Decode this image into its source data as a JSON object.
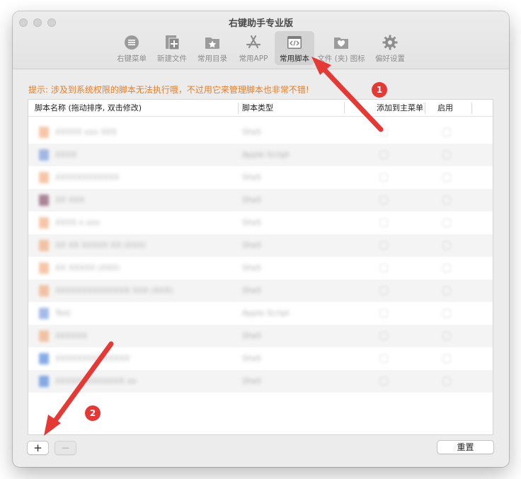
{
  "window": {
    "title": "右键助手专业版"
  },
  "toolbar": {
    "items": [
      {
        "label": "右键菜单",
        "icon": "menu-list-icon"
      },
      {
        "label": "新建文件",
        "icon": "new-file-icon"
      },
      {
        "label": "常用目录",
        "icon": "folder-star-icon"
      },
      {
        "label": "常用APP",
        "icon": "app-store-icon"
      },
      {
        "label": "常用脚本",
        "icon": "script-window-icon",
        "selected": true
      },
      {
        "label": "文件 (夹) 图标",
        "icon": "folder-heart-icon"
      },
      {
        "label": "偏好设置",
        "icon": "gear-icon"
      }
    ]
  },
  "hint": "提示: 涉及到系统权限的脚本无法执行哦，不过用它来管理脚本也非常不错!",
  "table": {
    "headers": {
      "name": "脚本名称 (拖动排序, 双击修改)",
      "type": "脚本类型",
      "add_to_menu": "添加到主菜单",
      "enabled": "启用"
    },
    "rows": [
      {
        "name": "XXXXX xxx XXX",
        "type": "Shell",
        "icon_color": "#f0a070"
      },
      {
        "name": "XXXX",
        "type": "Apple Script",
        "icon_color": "#6a8fd8"
      },
      {
        "name": "XXXXXXXXXXXX",
        "type": "Shell",
        "icon_color": "#f0a070"
      },
      {
        "name": "XX XXX",
        "type": "Shell",
        "icon_color": "#7a3a5a"
      },
      {
        "name": "XXXX x xxx",
        "type": "Shell",
        "icon_color": "#f0a070"
      },
      {
        "name": "XX XX XXXXX XX (XXX)",
        "type": "Shell",
        "icon_color": "#f0a070"
      },
      {
        "name": "XX XXXXX (XXX)",
        "type": "Shell",
        "icon_color": "#f0a070"
      },
      {
        "name": "XXXXXXXXXXXXXX XXX (XXX)",
        "type": "Shell",
        "icon_color": "#f0a070"
      },
      {
        "name": "Test",
        "type": "Apple Script",
        "icon_color": "#6a8fd8"
      },
      {
        "name": "XXXXXX",
        "type": "Shell",
        "icon_color": "#f0a070"
      },
      {
        "name": "XXXXXXXXXXXXXX",
        "type": "Shell",
        "icon_color": "#3a78d8"
      },
      {
        "name": "XXXXXXXXXXXXX xx",
        "type": "Shell",
        "icon_color": "#3a78d8"
      }
    ]
  },
  "buttons": {
    "add": "+",
    "remove": "−",
    "reset": "重置"
  },
  "annotations": {
    "marker1": "1",
    "marker2": "2",
    "color": "#e53935"
  }
}
